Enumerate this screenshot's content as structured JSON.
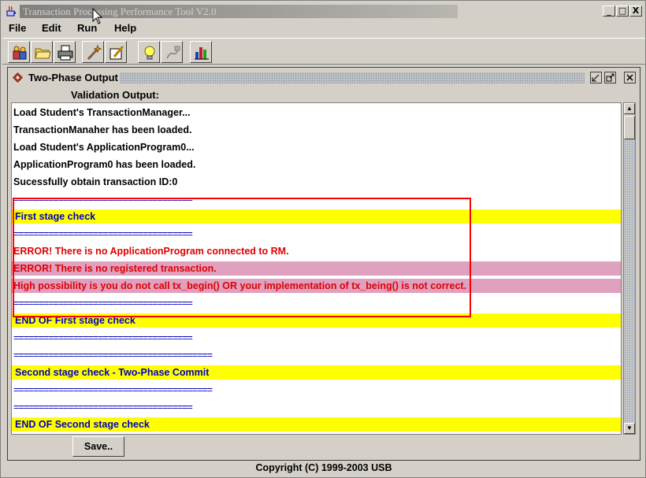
{
  "window": {
    "title": "Transaction Processing Performance Tool V2.0",
    "controls": {
      "minimize": "_",
      "maximize": "□",
      "close": "X"
    }
  },
  "menu": [
    {
      "label": "File"
    },
    {
      "label": "Edit"
    },
    {
      "label": "Run"
    },
    {
      "label": "Help"
    }
  ],
  "toolbar": {
    "icons": [
      "people-icon",
      "folder-icon",
      "printer-icon",
      "wand-icon",
      "edit-doc-icon",
      "lightbulb-icon",
      "plug-icon",
      "chart-icon"
    ]
  },
  "frame": {
    "title": "Two-Phase Output",
    "label": "Validation Output:",
    "save_label": "Save..",
    "lines": [
      {
        "text": "Load Student's TransactionManager...",
        "style": "black"
      },
      {
        "text": "TransactionManaher has been loaded.",
        "style": "black"
      },
      {
        "text": "Load Student's ApplicationProgram0...",
        "style": "black"
      },
      {
        "text": "ApplicationProgram0 has been loaded.",
        "style": "black"
      },
      {
        "text": "Sucessfully obtain transaction ID:0",
        "style": "black"
      },
      {
        "text": "====================================",
        "style": "sep"
      },
      {
        "text": "First stage check",
        "style": "yellow"
      },
      {
        "text": "====================================",
        "style": "sep"
      },
      {
        "text": "ERROR! There is no ApplicationProgram connected to RM.",
        "style": "red"
      },
      {
        "text": "ERROR! There is no registered transaction.",
        "style": "pink"
      },
      {
        "text": "High possibility is you do not call tx_begin() OR your implementation of tx_being() is not correct.",
        "style": "pink"
      },
      {
        "text": "====================================",
        "style": "sep"
      },
      {
        "text": "END OF First stage check",
        "style": "yellow"
      },
      {
        "text": "====================================",
        "style": "sep"
      },
      {
        "text": "========================================",
        "style": "sep"
      },
      {
        "text": "Second stage check - Two-Phase Commit",
        "style": "yellow"
      },
      {
        "text": "========================================",
        "style": "sep"
      },
      {
        "text": "====================================",
        "style": "sep"
      },
      {
        "text": "END OF Second stage check",
        "style": "yellow"
      }
    ]
  },
  "footer": "Copyright (C) 1999-2003 USB"
}
